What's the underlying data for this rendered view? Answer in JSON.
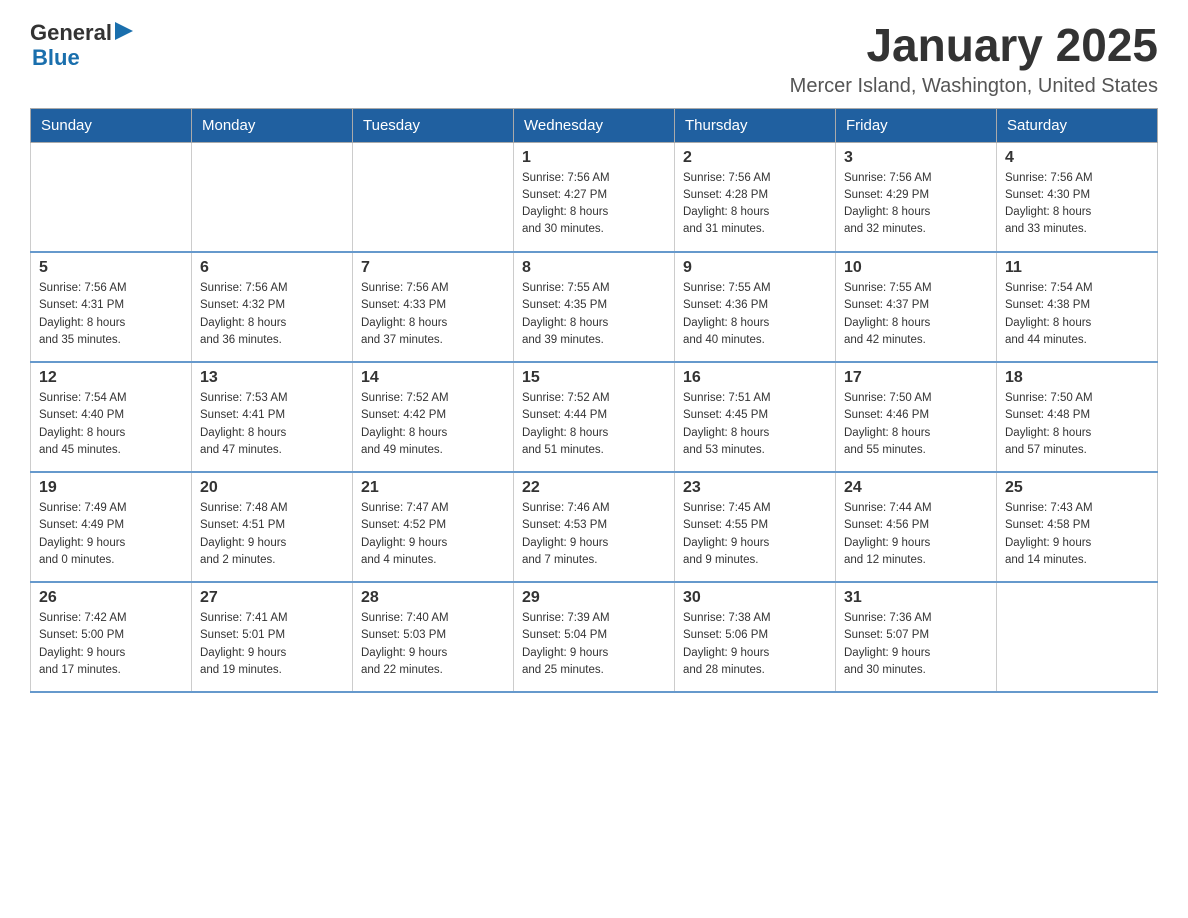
{
  "header": {
    "logo": {
      "general": "General",
      "blue": "Blue"
    },
    "title": "January 2025",
    "location": "Mercer Island, Washington, United States"
  },
  "days_of_week": [
    "Sunday",
    "Monday",
    "Tuesday",
    "Wednesday",
    "Thursday",
    "Friday",
    "Saturday"
  ],
  "weeks": [
    [
      {
        "day": "",
        "info": ""
      },
      {
        "day": "",
        "info": ""
      },
      {
        "day": "",
        "info": ""
      },
      {
        "day": "1",
        "info": "Sunrise: 7:56 AM\nSunset: 4:27 PM\nDaylight: 8 hours\nand 30 minutes."
      },
      {
        "day": "2",
        "info": "Sunrise: 7:56 AM\nSunset: 4:28 PM\nDaylight: 8 hours\nand 31 minutes."
      },
      {
        "day": "3",
        "info": "Sunrise: 7:56 AM\nSunset: 4:29 PM\nDaylight: 8 hours\nand 32 minutes."
      },
      {
        "day": "4",
        "info": "Sunrise: 7:56 AM\nSunset: 4:30 PM\nDaylight: 8 hours\nand 33 minutes."
      }
    ],
    [
      {
        "day": "5",
        "info": "Sunrise: 7:56 AM\nSunset: 4:31 PM\nDaylight: 8 hours\nand 35 minutes."
      },
      {
        "day": "6",
        "info": "Sunrise: 7:56 AM\nSunset: 4:32 PM\nDaylight: 8 hours\nand 36 minutes."
      },
      {
        "day": "7",
        "info": "Sunrise: 7:56 AM\nSunset: 4:33 PM\nDaylight: 8 hours\nand 37 minutes."
      },
      {
        "day": "8",
        "info": "Sunrise: 7:55 AM\nSunset: 4:35 PM\nDaylight: 8 hours\nand 39 minutes."
      },
      {
        "day": "9",
        "info": "Sunrise: 7:55 AM\nSunset: 4:36 PM\nDaylight: 8 hours\nand 40 minutes."
      },
      {
        "day": "10",
        "info": "Sunrise: 7:55 AM\nSunset: 4:37 PM\nDaylight: 8 hours\nand 42 minutes."
      },
      {
        "day": "11",
        "info": "Sunrise: 7:54 AM\nSunset: 4:38 PM\nDaylight: 8 hours\nand 44 minutes."
      }
    ],
    [
      {
        "day": "12",
        "info": "Sunrise: 7:54 AM\nSunset: 4:40 PM\nDaylight: 8 hours\nand 45 minutes."
      },
      {
        "day": "13",
        "info": "Sunrise: 7:53 AM\nSunset: 4:41 PM\nDaylight: 8 hours\nand 47 minutes."
      },
      {
        "day": "14",
        "info": "Sunrise: 7:52 AM\nSunset: 4:42 PM\nDaylight: 8 hours\nand 49 minutes."
      },
      {
        "day": "15",
        "info": "Sunrise: 7:52 AM\nSunset: 4:44 PM\nDaylight: 8 hours\nand 51 minutes."
      },
      {
        "day": "16",
        "info": "Sunrise: 7:51 AM\nSunset: 4:45 PM\nDaylight: 8 hours\nand 53 minutes."
      },
      {
        "day": "17",
        "info": "Sunrise: 7:50 AM\nSunset: 4:46 PM\nDaylight: 8 hours\nand 55 minutes."
      },
      {
        "day": "18",
        "info": "Sunrise: 7:50 AM\nSunset: 4:48 PM\nDaylight: 8 hours\nand 57 minutes."
      }
    ],
    [
      {
        "day": "19",
        "info": "Sunrise: 7:49 AM\nSunset: 4:49 PM\nDaylight: 9 hours\nand 0 minutes."
      },
      {
        "day": "20",
        "info": "Sunrise: 7:48 AM\nSunset: 4:51 PM\nDaylight: 9 hours\nand 2 minutes."
      },
      {
        "day": "21",
        "info": "Sunrise: 7:47 AM\nSunset: 4:52 PM\nDaylight: 9 hours\nand 4 minutes."
      },
      {
        "day": "22",
        "info": "Sunrise: 7:46 AM\nSunset: 4:53 PM\nDaylight: 9 hours\nand 7 minutes."
      },
      {
        "day": "23",
        "info": "Sunrise: 7:45 AM\nSunset: 4:55 PM\nDaylight: 9 hours\nand 9 minutes."
      },
      {
        "day": "24",
        "info": "Sunrise: 7:44 AM\nSunset: 4:56 PM\nDaylight: 9 hours\nand 12 minutes."
      },
      {
        "day": "25",
        "info": "Sunrise: 7:43 AM\nSunset: 4:58 PM\nDaylight: 9 hours\nand 14 minutes."
      }
    ],
    [
      {
        "day": "26",
        "info": "Sunrise: 7:42 AM\nSunset: 5:00 PM\nDaylight: 9 hours\nand 17 minutes."
      },
      {
        "day": "27",
        "info": "Sunrise: 7:41 AM\nSunset: 5:01 PM\nDaylight: 9 hours\nand 19 minutes."
      },
      {
        "day": "28",
        "info": "Sunrise: 7:40 AM\nSunset: 5:03 PM\nDaylight: 9 hours\nand 22 minutes."
      },
      {
        "day": "29",
        "info": "Sunrise: 7:39 AM\nSunset: 5:04 PM\nDaylight: 9 hours\nand 25 minutes."
      },
      {
        "day": "30",
        "info": "Sunrise: 7:38 AM\nSunset: 5:06 PM\nDaylight: 9 hours\nand 28 minutes."
      },
      {
        "day": "31",
        "info": "Sunrise: 7:36 AM\nSunset: 5:07 PM\nDaylight: 9 hours\nand 30 minutes."
      },
      {
        "day": "",
        "info": ""
      }
    ]
  ]
}
